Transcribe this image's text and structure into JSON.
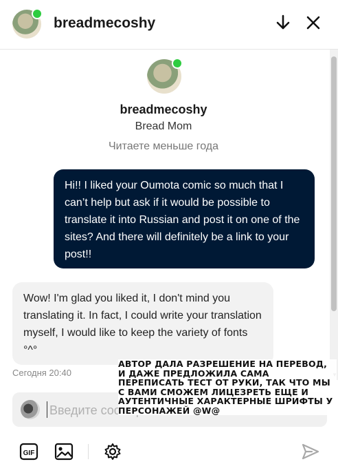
{
  "header": {
    "username": "breadmecoshy",
    "minimize_icon": "arrow-down-icon",
    "close_icon": "close-icon"
  },
  "profile": {
    "username": "breadmecoshy",
    "title": "Bread Mom",
    "status": "Читаете меньше года"
  },
  "messages": [
    {
      "direction": "outgoing",
      "text": "Hi!! I liked your Oumota comic so much that I can’t help but ask if it would be possible to translate it into Russian and post it on one of the sites? And there will definitely be a link to your post!!"
    },
    {
      "direction": "incoming",
      "text": "Wow! I'm glad you liked it, I don't mind you translating it. In fact, I could write your translation myself, I would like to keep the variety of fonts °^°"
    }
  ],
  "timestamp": "Сегодня 20:40",
  "composer": {
    "placeholder": "Введите сообщение"
  },
  "toolbar": {
    "gif_label": "GIF",
    "icons": [
      "gif-icon",
      "image-icon",
      "gear-icon",
      "send-icon"
    ]
  },
  "overlay_note": "Автор дала разрешение на перевод, и даже предложила сама переписать тест от руки, так что мы с вами сможем лицезреть еще и аутентичные характерные шрифты у персонажей @w@",
  "colors": {
    "online": "#2ecc40",
    "outgoing_bubble": "#001935",
    "incoming_bubble": "#f2f2f2"
  }
}
